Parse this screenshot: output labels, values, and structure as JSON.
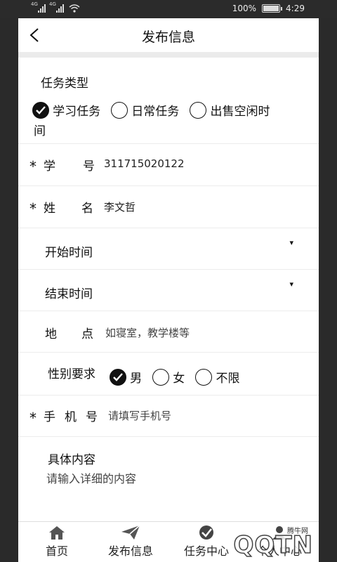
{
  "statusbar": {
    "net1": "4G",
    "net2": "4G",
    "battery_pct": "100%",
    "time": "4:29"
  },
  "header": {
    "title": "发布信息"
  },
  "task_type": {
    "label": "任务类型",
    "options": [
      "学习任务",
      "日常任务",
      "出售空闲时"
    ],
    "wrap_text": "间",
    "selected": "学习任务"
  },
  "student_id": {
    "label1": "学",
    "label2": "号",
    "value": "311715020122",
    "required_mark": "*"
  },
  "name": {
    "label1": "姓",
    "label2": "名",
    "value": "李文哲",
    "required_mark": "*"
  },
  "start_time": {
    "label": "开始时间",
    "caret": "▾"
  },
  "end_time": {
    "label": "结束时间",
    "caret": "▾"
  },
  "location": {
    "label1": "地",
    "label2": "点",
    "placeholder": "如寝室，教学楼等"
  },
  "gender": {
    "label": "性别要求",
    "options": [
      "男",
      "女",
      "不限"
    ],
    "selected": "男"
  },
  "phone": {
    "label1": "手",
    "label2": "机",
    "label3": "号",
    "placeholder": "请填写手机号",
    "required_mark": "*"
  },
  "details": {
    "label": "具体内容",
    "placeholder": "请输入详细的内容"
  },
  "tabbar": {
    "tabs": [
      {
        "label": "首页",
        "icon": "home-icon"
      },
      {
        "label": "发布信息",
        "icon": "send-icon"
      },
      {
        "label": "任务中心",
        "icon": "task-icon"
      },
      {
        "label": "个人中心",
        "icon": "user-icon"
      }
    ]
  },
  "watermark": {
    "text": "QQTN",
    "small": "腾牛网"
  }
}
